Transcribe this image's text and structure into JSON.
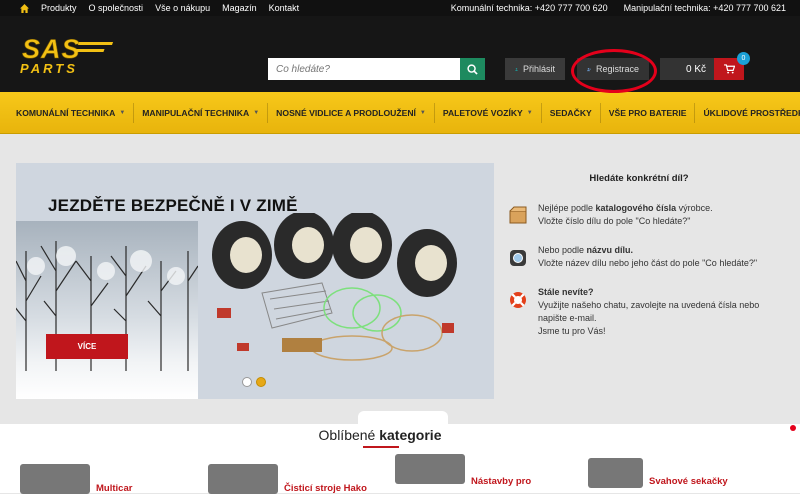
{
  "topbar": {
    "links": [
      "Produkty",
      "O společnosti",
      "Vše o nákupu",
      "Magazín",
      "Kontakt"
    ],
    "phone_communal": "Komunální technika: +420 777 700 620",
    "phone_handling": "Manipulační technika: +420 777 700 621"
  },
  "header": {
    "logo_text_top": "SAS",
    "logo_text_bottom": "PARTS",
    "search_placeholder": "Co hledáte?",
    "login_label": "Přihlásit",
    "register_label": "Registrace",
    "cart_total": "0 Kč",
    "cart_count": "0"
  },
  "nav": {
    "items": [
      {
        "label": "KOMUNÁLNÍ TECHNIKA",
        "dropdown": true
      },
      {
        "label": "MANIPULAČNÍ TECHNIKA",
        "dropdown": true
      },
      {
        "label": "NOSNÉ VIDLICE A PRODLOUŽENÍ",
        "dropdown": true
      },
      {
        "label": "PALETOVÉ VOZÍKY",
        "dropdown": true
      },
      {
        "label": "SEDAČKY",
        "dropdown": false
      },
      {
        "label": "VŠE PRO BATERIE",
        "dropdown": false
      },
      {
        "label": "ÚKLIDOVÉ PROSTŘEDKY",
        "dropdown": true
      }
    ]
  },
  "slider": {
    "title": "JEZDĚTE BEZPEČNĚ I V ZIMĚ",
    "button_label": "VÍCE",
    "slide_count": 2,
    "active_slide": 2
  },
  "sidebar": {
    "heading": "Hledáte konkrétní díl?",
    "tip1_a": "Nejlépe podle ",
    "tip1_b": "katalogového čísla",
    "tip1_c": " výrobce.",
    "tip1_d": "Vložte číslo dílu do pole \"Co hledáte?\"",
    "tip2_a": "Nebo podle ",
    "tip2_b": "názvu dílu.",
    "tip2_c": "Vložte název dílu nebo jeho část do pole \"Co hledáte?\"",
    "tip3_a": "Stále nevíte?",
    "tip3_b": "Využijte našeho chatu, zavolejte na uvedená čísla nebo napište e-mail.",
    "tip3_c": "Jsme tu pro Vás!"
  },
  "categories": {
    "heading_light": "Oblíbené ",
    "heading_bold": "kategorie",
    "items": [
      "Multicar",
      "Čisticí stroje Hako",
      "Nástavby pro",
      "Svahové sekačky"
    ]
  },
  "colors": {
    "accent_yellow": "#f2c014",
    "brand_red": "#c0161c",
    "search_green": "#1d8a5f",
    "annotation_red": "#e4001b"
  }
}
